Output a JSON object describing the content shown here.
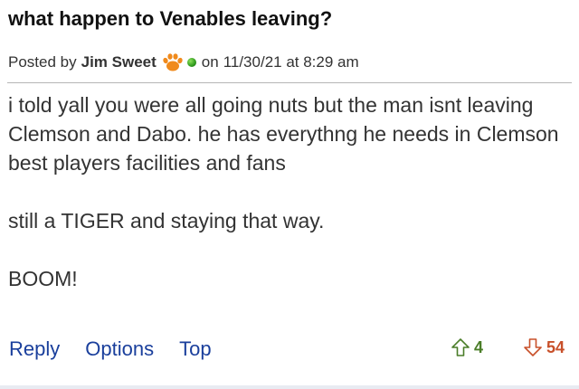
{
  "post": {
    "title": "what happen to Venables leaving?",
    "posted_by_label": "Posted by",
    "author": "Jim Sweet",
    "author_badge_icon": "tiger-paw-icon",
    "online_status_icon": "online-dot-icon",
    "date_prefix": "on",
    "date": "11/30/21 at 8:29 am",
    "body": {
      "p1": "i told yall you were all going nuts but the man isnt leaving Clemson and Dabo. he has everythng he needs in Clemson best players facilities and fans",
      "p2": "still a TIGER and staying that way.",
      "p3": "BOOM!"
    }
  },
  "actions": {
    "reply": "Reply",
    "options": "Options",
    "top": "Top"
  },
  "votes": {
    "up": "4",
    "down": "54",
    "up_color": "#4a7d28",
    "down_color": "#c8502a"
  },
  "colors": {
    "link": "#1a3f9c",
    "paw": "#f08a1c",
    "online": "#2f9a1d"
  }
}
